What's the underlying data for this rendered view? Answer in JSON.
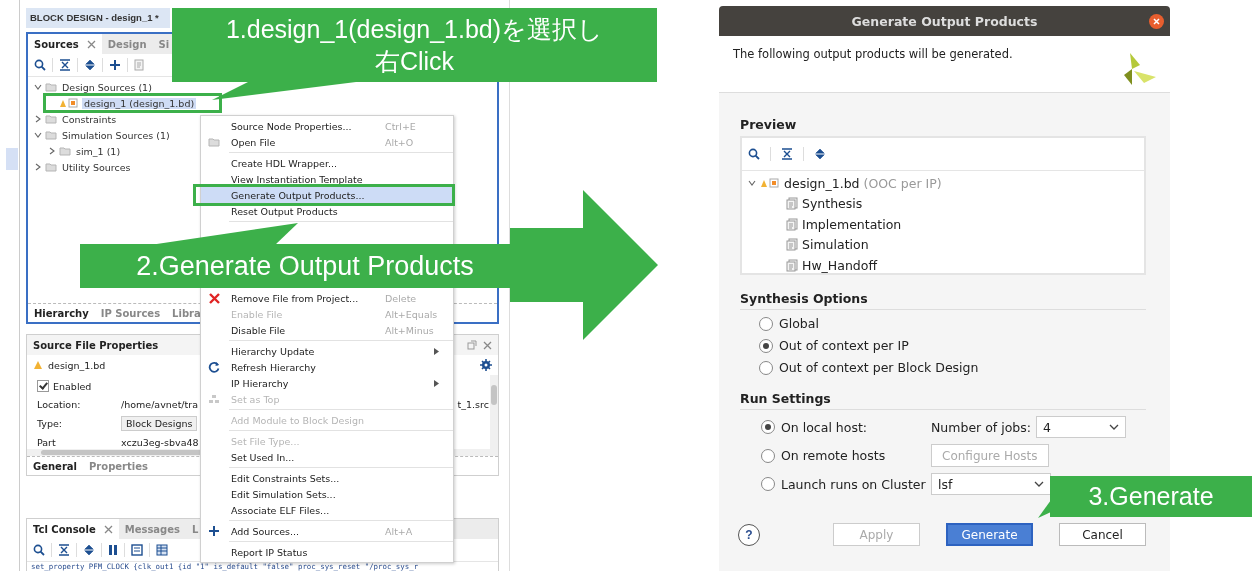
{
  "ide": {
    "editor_title": "BLOCK DESIGN - design_1 *",
    "sources_panel": {
      "tabs": [
        {
          "label": "Sources",
          "selected": true,
          "closable": true
        },
        {
          "label": "Design",
          "selected": false,
          "closable": false
        },
        {
          "label": "Si",
          "selected": false,
          "closable": false
        }
      ],
      "tree": [
        {
          "label": "Design Sources (1)",
          "kind": "folder",
          "expanded": true,
          "selected": false,
          "children": [
            {
              "label": "design_1 (design_1.bd)",
              "kind": "design",
              "selected": true
            }
          ]
        },
        {
          "label": "Constraints",
          "kind": "folder",
          "expanded": false,
          "selected": false
        },
        {
          "label": "Simulation Sources (1)",
          "kind": "folder",
          "expanded": true,
          "selected": false,
          "children": [
            {
              "label": "sim_1 (1)",
              "kind": "folder",
              "expanded": false,
              "selected": false
            }
          ]
        },
        {
          "label": "Utility Sources",
          "kind": "folder",
          "expanded": false,
          "selected": false
        }
      ],
      "bottom_tabs": [
        {
          "label": "Hierarchy",
          "selected": true
        },
        {
          "label": "IP Sources",
          "selected": false
        },
        {
          "label": "Libra",
          "selected": false
        }
      ]
    },
    "properties_panel": {
      "title": "Source File Properties",
      "file": "design_1.bd",
      "enabled": {
        "label": "Enabled",
        "checked": true
      },
      "fields": [
        {
          "label": "Location:",
          "value": "/home/avnet/tra",
          "value_end": "t_1.src",
          "kind": "text"
        },
        {
          "label": "Type:",
          "value": "Block Designs",
          "kind": "combo"
        },
        {
          "label": "Part",
          "value": "xczu3eg-sbva48",
          "kind": "text"
        }
      ],
      "tabs": [
        {
          "label": "General",
          "selected": true
        },
        {
          "label": "Properties",
          "selected": false
        }
      ]
    },
    "console": {
      "tabs": [
        {
          "label": "Tcl Console",
          "selected": true,
          "closable": true
        },
        {
          "label": "Messages",
          "selected": false,
          "closable": false
        },
        {
          "label": "L",
          "selected": false,
          "closable": false
        }
      ],
      "line": "set_property PFM_CLOCK {clk_out1 {id \"1\" is_default \"false\" proc_sys_reset \"/proc_sys_r"
    }
  },
  "context_menu": [
    {
      "kind": "item",
      "label": "Source Node Properties...",
      "shortcut": "Ctrl+E",
      "disabled": false,
      "selected": false
    },
    {
      "kind": "item",
      "label": "Open File",
      "shortcut": "Alt+O",
      "disabled": false,
      "selected": false
    },
    {
      "kind": "separator"
    },
    {
      "kind": "item",
      "label": "Create HDL Wrapper...",
      "disabled": false,
      "selected": false
    },
    {
      "kind": "item",
      "label": "View Instantiation Template",
      "disabled": false,
      "selected": false
    },
    {
      "kind": "item",
      "label": "Generate Output Products...",
      "disabled": false,
      "selected": true
    },
    {
      "kind": "item",
      "label": "Reset Output Products",
      "disabled": false,
      "selected": false
    },
    {
      "kind": "separator"
    },
    {
      "kind": "blank"
    },
    {
      "kind": "blank"
    },
    {
      "kind": "blank"
    },
    {
      "kind": "item",
      "label": "Remove File from Project...",
      "shortcut": "Delete",
      "disabled": false,
      "selected": false
    },
    {
      "kind": "item",
      "label": "Enable File",
      "shortcut": "Alt+Equals",
      "disabled": true,
      "selected": false
    },
    {
      "kind": "item",
      "label": "Disable File",
      "shortcut": "Alt+Minus",
      "disabled": false,
      "selected": false
    },
    {
      "kind": "separator"
    },
    {
      "kind": "item",
      "label": "Hierarchy Update",
      "submenu": true,
      "disabled": false,
      "selected": false
    },
    {
      "kind": "item",
      "label": "Refresh Hierarchy",
      "disabled": false,
      "selected": false
    },
    {
      "kind": "item",
      "label": "IP Hierarchy",
      "submenu": true,
      "disabled": false,
      "selected": false
    },
    {
      "kind": "item",
      "label": "Set as Top",
      "disabled": true,
      "selected": false
    },
    {
      "kind": "separator"
    },
    {
      "kind": "item",
      "label": "Add Module to Block Design",
      "disabled": true,
      "selected": false
    },
    {
      "kind": "separator"
    },
    {
      "kind": "item",
      "label": "Set File Type...",
      "disabled": true,
      "selected": false
    },
    {
      "kind": "item",
      "label": "Set Used In...",
      "disabled": false,
      "selected": false
    },
    {
      "kind": "separator"
    },
    {
      "kind": "item",
      "label": "Edit Constraints Sets...",
      "disabled": false,
      "selected": false
    },
    {
      "kind": "item",
      "label": "Edit Simulation Sets...",
      "disabled": false,
      "selected": false
    },
    {
      "kind": "item",
      "label": "Associate ELF Files...",
      "disabled": false,
      "selected": false
    },
    {
      "kind": "separator"
    },
    {
      "kind": "item",
      "label": "Add Sources...",
      "shortcut": "Alt+A",
      "disabled": false,
      "selected": false
    },
    {
      "kind": "separator"
    },
    {
      "kind": "item",
      "label": "Report IP Status",
      "disabled": false,
      "selected": false
    }
  ],
  "dialog": {
    "title": "Generate Output Products",
    "message": "The following output products will be generated.",
    "preview": {
      "title": "Preview",
      "tree": [
        {
          "label": "design_1.bd",
          "note": "(OOC per IP)",
          "kind": "design",
          "expanded": true,
          "children": [
            {
              "label": "Synthesis",
              "kind": "file"
            },
            {
              "label": "Implementation",
              "kind": "file"
            },
            {
              "label": "Simulation",
              "kind": "file"
            },
            {
              "label": "Hw_Handoff",
              "kind": "file"
            }
          ]
        }
      ]
    },
    "synthesis_options": {
      "title": "Synthesis Options",
      "options": [
        {
          "label": "Global",
          "selected": false
        },
        {
          "label": "Out of context per IP",
          "selected": true
        },
        {
          "label": "Out of context per Block Design",
          "selected": false
        }
      ]
    },
    "run_settings": {
      "title": "Run Settings",
      "options": [
        {
          "label": "On local host:",
          "selected": true,
          "control": {
            "kind": "select",
            "label": "Number of jobs:",
            "value": "4"
          }
        },
        {
          "label": "On remote hosts",
          "selected": false,
          "control": {
            "kind": "button",
            "label": "Configure Hosts",
            "disabled": true
          }
        },
        {
          "label": "Launch runs on Cluster",
          "selected": false,
          "control": {
            "kind": "select",
            "value": "lsf"
          }
        }
      ]
    },
    "help_button": "?",
    "buttons": [
      {
        "label": "Apply",
        "disabled": true,
        "primary": false
      },
      {
        "label": "Generate",
        "disabled": false,
        "primary": true
      },
      {
        "label": "Cancel",
        "disabled": false,
        "primary": false
      }
    ]
  },
  "callouts": [
    {
      "text": "1.design_1(design_1.bd)を選択し右Click"
    },
    {
      "text": "2.Generate Output Products"
    },
    {
      "text": "3.Generate"
    }
  ]
}
